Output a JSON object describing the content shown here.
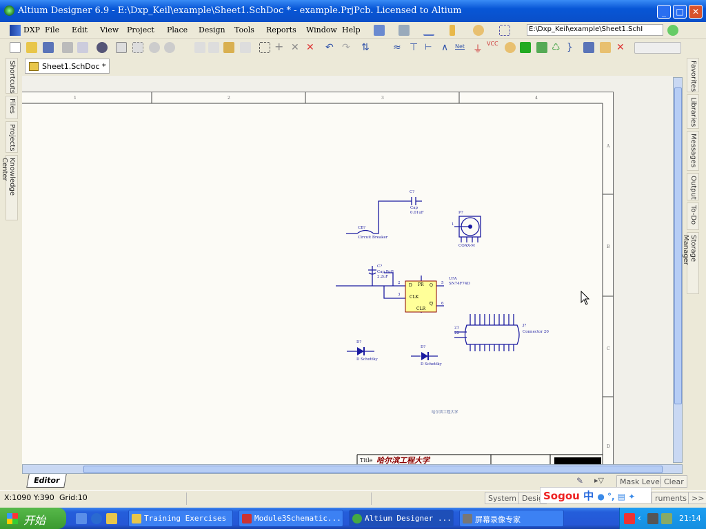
{
  "window": {
    "title": "Altium Designer 6.9 - E:\\Dxp_Keil\\example\\Sheet1.SchDoc * - example.PrjPcb. Licensed to Altium",
    "minimize": "_",
    "maximize": "□",
    "close": "✕"
  },
  "menu": [
    {
      "label": "DXP"
    },
    {
      "label": "File"
    },
    {
      "label": "Edit"
    },
    {
      "label": "View"
    },
    {
      "label": "Project"
    },
    {
      "label": "Place"
    },
    {
      "label": "Design"
    },
    {
      "label": "Tools"
    },
    {
      "label": "Reports"
    },
    {
      "label": "Window"
    },
    {
      "label": "Help"
    }
  ],
  "path_box": "E:\\Dxp_Keil\\example\\Sheet1.SchI",
  "document_tab": "Sheet1.SchDoc *",
  "left_panels": [
    "Shortcuts",
    "Files",
    "Projects",
    "Knowledge Center"
  ],
  "right_panels": [
    "Favorites",
    "Libraries",
    "Messages",
    "Output",
    "To-Do",
    "Storage Manager"
  ],
  "sheet": {
    "zones_top": [
      "1",
      "2",
      "3",
      "4"
    ],
    "zones_right": [
      "A",
      "B",
      "C",
      "D"
    ],
    "components": {
      "cap": {
        "designator": "C?",
        "comment": "Cap",
        "value": "0.01uF"
      },
      "breaker": {
        "designator": "CB?",
        "comment": "Circuit Breaker"
      },
      "coax": {
        "designator": "P?",
        "comment": "COAX-M",
        "pin": "1"
      },
      "cap_pol": {
        "designator": "C?",
        "comment": "Cap Pol1",
        "value": "2.2uF"
      },
      "flipflop": {
        "designator": "U?A",
        "comment": "SN74F74D",
        "pins": {
          "d": "D",
          "clk": "CLK",
          "pr": "PR",
          "clr": "CLR",
          "q": "Q",
          "qn": "Q",
          "n2": "2",
          "n3": "3",
          "n5": "5",
          "n6": "6"
        }
      },
      "connector": {
        "designator": "J?",
        "comment": "Connector 20",
        "pin21": "21",
        "pin22": "22"
      },
      "diode1": {
        "designator": "D?",
        "comment": "D Schottky"
      },
      "diode2": {
        "designator": "D?",
        "comment": "D Schottky"
      }
    },
    "text": "哈尔滨工程大学",
    "title_block": {
      "label": "Title",
      "value": "哈尔滨工程大学"
    }
  },
  "bottom": {
    "editor_tab": "Editor",
    "mask_level": "Mask Level",
    "clear": "Clear"
  },
  "status": {
    "coords": "X:1090 Y:390",
    "grid": "Grid:10",
    "system": "System",
    "design": "Desig",
    "instruments": "ruments",
    "more": ">>"
  },
  "sogou": {
    "brand": "Sogou",
    "mode": "中"
  },
  "taskbar": {
    "start": "开始",
    "tasks": [
      "Training Exercises",
      "Module3Schematic...",
      "Altium Designer ...",
      "屏幕录像专家"
    ],
    "clock": "21:14"
  },
  "colors": {
    "titlebar": "#0856d6",
    "wire": "#1a1aa0",
    "component_fill": "#ffff99",
    "title_text": "#8b0000"
  }
}
